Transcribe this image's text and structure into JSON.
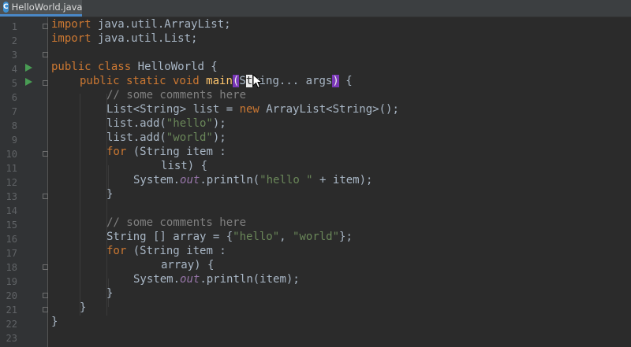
{
  "tab": {
    "icon_letter": "C",
    "label": "HelloWorld.java"
  },
  "colors": {
    "background": "#2b2b2b",
    "keyword": "#cc7832",
    "string": "#6a8759",
    "comment": "#808080",
    "method": "#ffc66d",
    "static_field": "#9876aa",
    "bracket_highlight": "#7a37b8",
    "run_icon": "#499c54",
    "tab_underline": "#4a88c7"
  },
  "editor": {
    "line_numbers": [
      "1",
      "2",
      "3",
      "4",
      "5",
      "6",
      "7",
      "8",
      "9",
      "10",
      "11",
      "12",
      "13",
      "14",
      "15",
      "16",
      "17",
      "18",
      "19",
      "20",
      "21",
      "22",
      "23"
    ],
    "code": {
      "l1": {
        "kw": "import",
        "rest": " java.util.ArrayList;"
      },
      "l2": {
        "kw": "import",
        "rest": " java.util.List;"
      },
      "l4": {
        "kw": "public class",
        "rest": " HelloWorld {"
      },
      "l5": {
        "kw": "public static void",
        "fn": "main",
        "open": "(",
        "pre": "S",
        "caret": "t",
        "post": "ring... args",
        "close": ")",
        "tail": " {"
      },
      "l6": {
        "cmt": "// some comments here"
      },
      "l7": {
        "a": "List<String> list = ",
        "kw": "new",
        "b": " ArrayList<String>();"
      },
      "l8": {
        "a": "list.add(",
        "str": "\"hello\"",
        "b": ");"
      },
      "l9": {
        "a": "list.add(",
        "str": "\"world\"",
        "b": ");"
      },
      "l10": {
        "kw": "for",
        "rest": " (String item :"
      },
      "l11": {
        "rest": "list) {"
      },
      "l12": {
        "a": "System.",
        "st": "out",
        "b": ".println(",
        "str": "\"hello \"",
        "c": " + item);"
      },
      "l13": {
        "rest": "}"
      },
      "l15": {
        "cmt": "// some comments here"
      },
      "l16": {
        "a": "String [] array = {",
        "s1": "\"hello\"",
        "b": ", ",
        "s2": "\"world\"",
        "c": "};"
      },
      "l17": {
        "kw": "for",
        "rest": " (String item :"
      },
      "l18": {
        "rest": "array) {"
      },
      "l19": {
        "a": "System.",
        "st": "out",
        "b": ".println(item);"
      },
      "l20": {
        "rest": "}"
      },
      "l21": {
        "rest": "}"
      },
      "l22": {
        "rest": "}"
      }
    }
  }
}
